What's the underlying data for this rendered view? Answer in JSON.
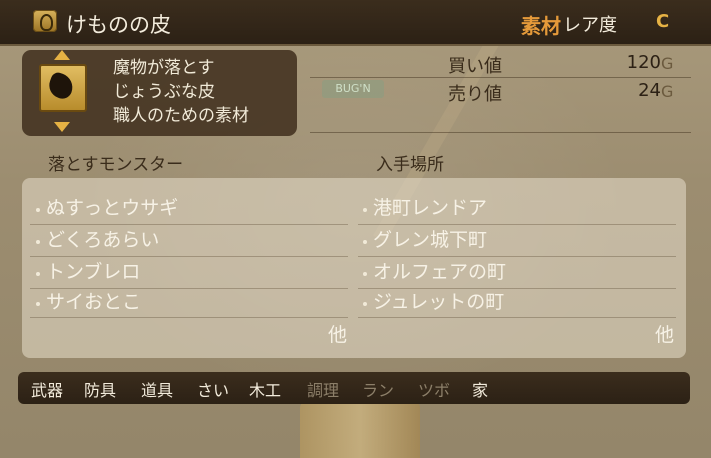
{
  "item": {
    "name": "けものの皮",
    "category": "素材",
    "rarity_label": "レア度",
    "rarity_value": "C",
    "description": [
      "魔物が落とす",
      "じょうぶな皮",
      "職人のための素材"
    ],
    "chip_text": "BUG'N"
  },
  "prices": {
    "buy_label": "買い値",
    "buy_value": "120",
    "sell_label": "売り値",
    "sell_value": "24",
    "currency": "G"
  },
  "sections": {
    "monsters_header": "落とすモンスター",
    "locations_header": "入手場所"
  },
  "monsters": [
    "ぬすっとウサギ",
    "どくろあらい",
    "トンブレロ",
    "サイおとこ"
  ],
  "locations": [
    "港町レンドア",
    "グレン城下町",
    "オルフェアの町",
    "ジュレットの町"
  ],
  "more_label": "他",
  "tabs": [
    {
      "label": "武器",
      "active": true
    },
    {
      "label": "防具",
      "active": true
    },
    {
      "label": "道具",
      "active": true
    },
    {
      "label": "さい",
      "active": true
    },
    {
      "label": "木工",
      "active": true
    },
    {
      "label": "調理",
      "active": false
    },
    {
      "label": "ラン",
      "active": false
    },
    {
      "label": "ツボ",
      "active": false
    },
    {
      "label": "家",
      "active": true
    }
  ],
  "colors": {
    "category": "#e59a3a",
    "rarity": "#e6b244",
    "text_light": "#f7f2e6",
    "text_dark": "#3a2c1b"
  }
}
